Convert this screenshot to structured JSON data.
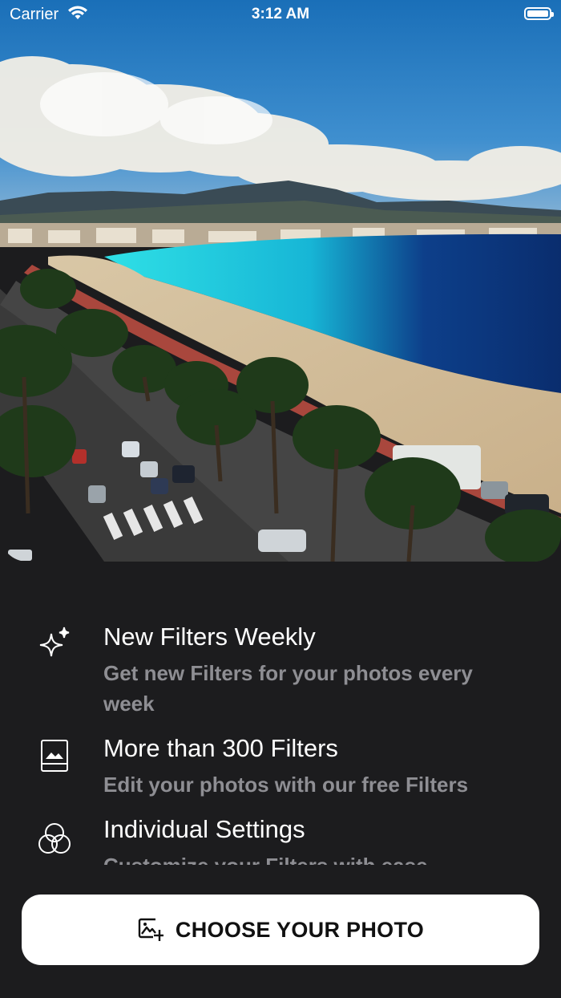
{
  "status_bar": {
    "carrier": "Carrier",
    "time": "3:12 AM",
    "battery_level": 1.0
  },
  "hero": {
    "image": "coastal-city-photo"
  },
  "features": [
    {
      "icon": "sparkles-icon",
      "title": "New Filters Weekly",
      "description": "Get new Filters for your photos every week"
    },
    {
      "icon": "photo-book-icon",
      "title": "More than 300 Filters",
      "description": "Edit your photos with our free Filters"
    },
    {
      "icon": "circles-overlap-icon",
      "title": "Individual Settings",
      "description": "Customize your Filters with ease"
    }
  ],
  "cta": {
    "icon": "add-photo-icon",
    "label": "CHOOSE YOUR PHOTO"
  },
  "colors": {
    "background": "#1c1c1e",
    "secondary_text": "#8e8e93",
    "button_background": "#ffffff"
  }
}
